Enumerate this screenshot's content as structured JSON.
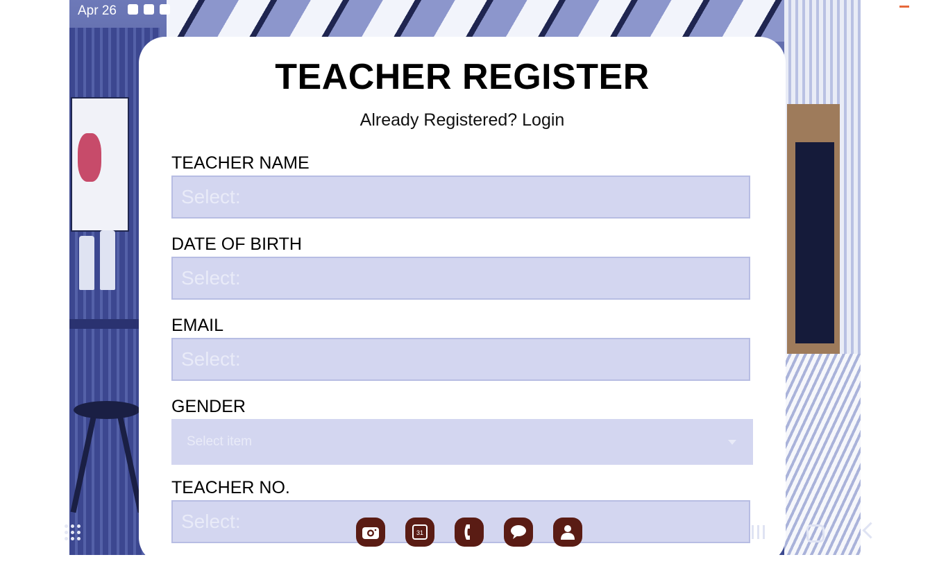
{
  "status_bar": {
    "date": "Apr 26",
    "icons": [
      "gallery-icon",
      "alert-icon",
      "sync-icon"
    ]
  },
  "form": {
    "title": "TEACHER REGISTER",
    "login_prompt": "Already Registered? Login",
    "fields": [
      {
        "label": "TEACHER NAME",
        "placeholder": "Select:",
        "type": "text"
      },
      {
        "label": "DATE OF BIRTH",
        "placeholder": "Select:",
        "type": "text"
      },
      {
        "label": "EMAIL",
        "placeholder": "Select:",
        "type": "text"
      },
      {
        "label": "GENDER",
        "placeholder": "Select item",
        "type": "dropdown"
      },
      {
        "label": "TEACHER NO.",
        "placeholder": "Select:",
        "type": "text"
      }
    ]
  },
  "dock": {
    "apps": [
      "camera-icon",
      "calendar-icon",
      "phone-icon",
      "messages-icon",
      "contacts-icon"
    ],
    "calendar_day": "31",
    "icon_bg_color": "#5a1c14"
  },
  "colors": {
    "input_bg": "#d3d6f0",
    "card_bg": "#ffffff"
  }
}
